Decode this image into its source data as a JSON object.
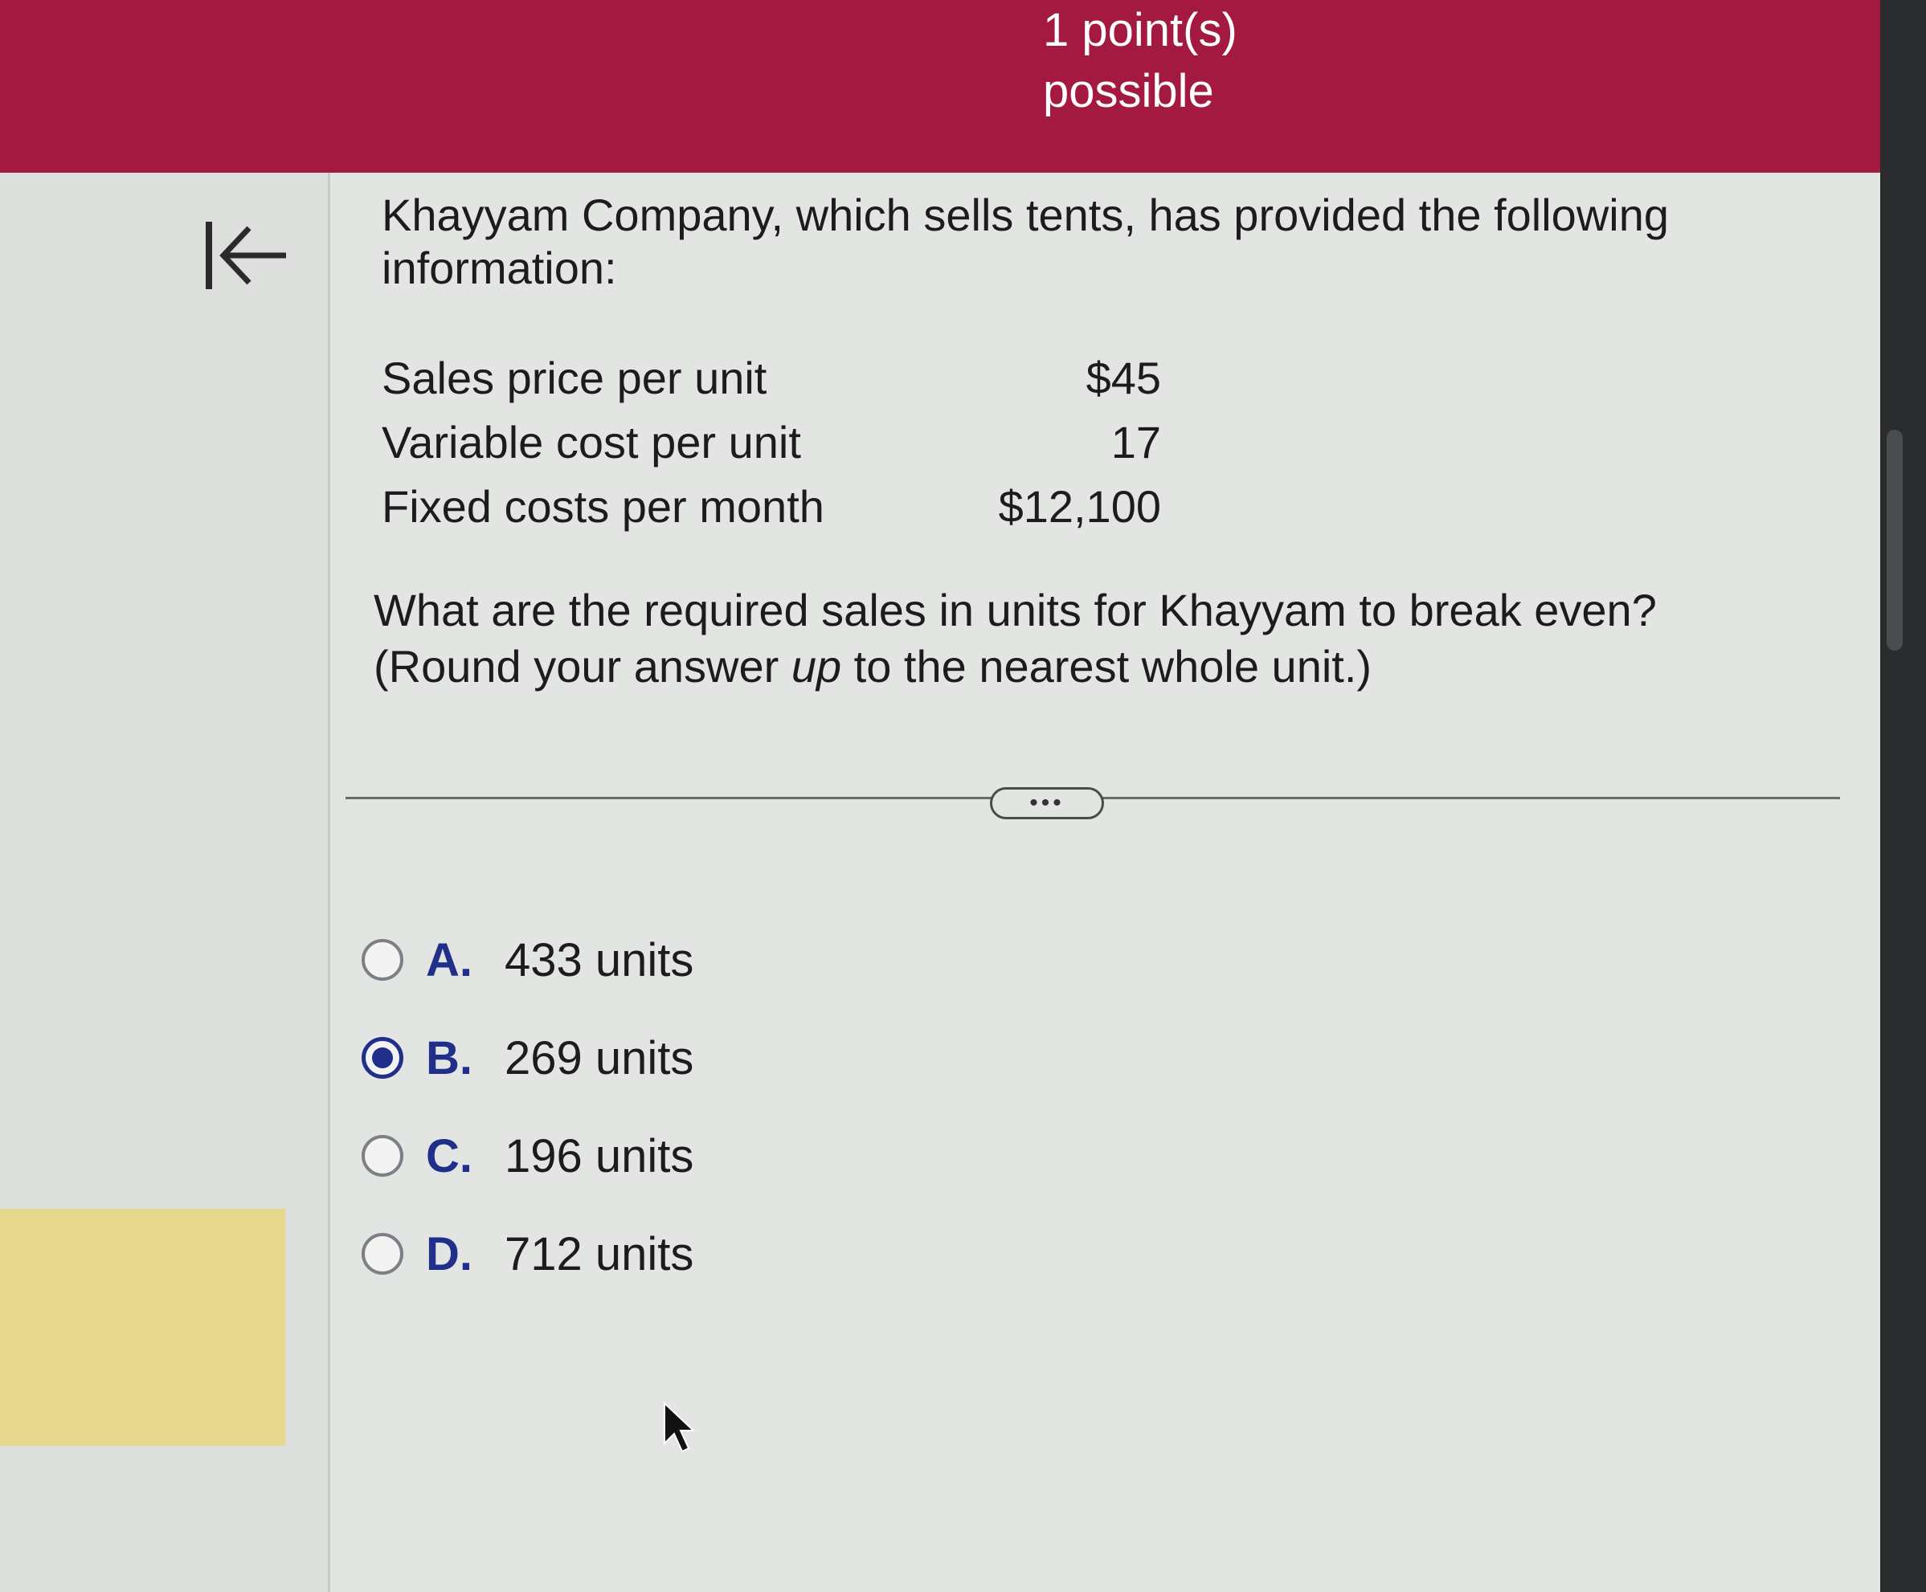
{
  "header": {
    "points_line1": "1 point(s)",
    "points_line2": "possible"
  },
  "nav": {
    "back_icon": "back-to-start-icon"
  },
  "question": {
    "intro": "Khayyam Company, which sells tents, has provided the following information:",
    "rows": [
      {
        "label": "Sales price per unit",
        "value": "$45"
      },
      {
        "label": "Variable cost per unit",
        "value": "17"
      },
      {
        "label": "Fixed costs per month",
        "value": "$12,100"
      }
    ],
    "prompt_part1": "What are the required sales in units for Khayyam to break even? (Round your answer ",
    "prompt_emphasis": "up",
    "prompt_part2": " to the nearest whole unit.)"
  },
  "more_button": "•••",
  "options": [
    {
      "letter": "A.",
      "text": "433 units",
      "selected": false
    },
    {
      "letter": "B.",
      "text": "269 units",
      "selected": true
    },
    {
      "letter": "C.",
      "text": "196 units",
      "selected": false
    },
    {
      "letter": "D.",
      "text": "712 units",
      "selected": false
    }
  ],
  "colors": {
    "header_bg": "#a3193f",
    "accent": "#1f2f8a",
    "highlight": "#e6d88c"
  }
}
